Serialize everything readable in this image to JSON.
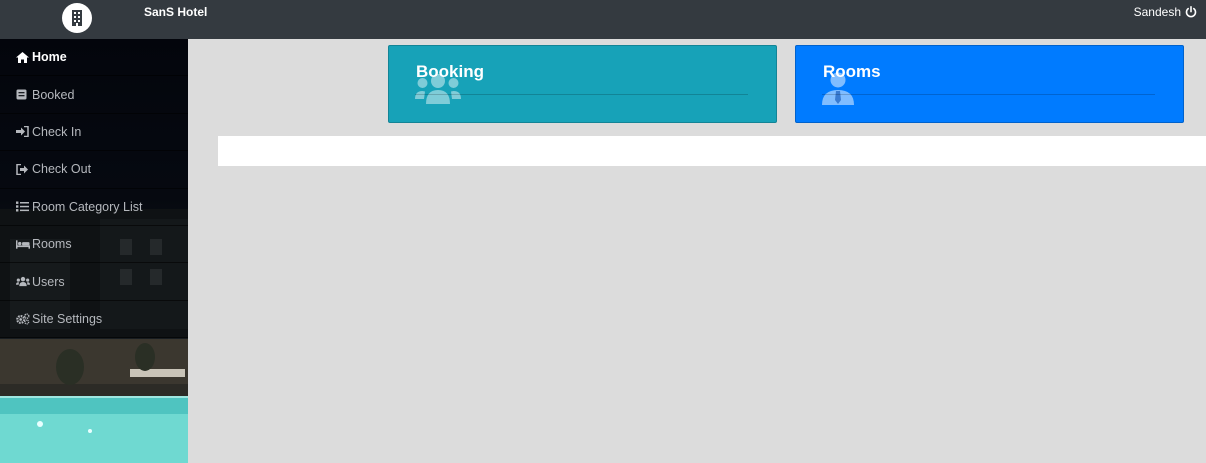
{
  "header": {
    "brand": "SanS Hotel",
    "logo_icon": "hotel-building-icon",
    "user_name": "Sandesh",
    "logout_icon": "power-icon"
  },
  "sidebar": {
    "items": [
      {
        "label": "Home",
        "icon": "home-icon",
        "active": true
      },
      {
        "label": "Booked",
        "icon": "book-icon",
        "active": false
      },
      {
        "label": "Check In",
        "icon": "sign-in-icon",
        "active": false
      },
      {
        "label": "Check Out",
        "icon": "sign-out-icon",
        "active": false
      },
      {
        "label": "Room Category List",
        "icon": "list-icon",
        "active": false
      },
      {
        "label": "Rooms",
        "icon": "bed-icon",
        "active": false
      },
      {
        "label": "Users",
        "icon": "users-icon",
        "active": false
      },
      {
        "label": "Site Settings",
        "icon": "cogs-icon",
        "active": false
      }
    ]
  },
  "cards": [
    {
      "title": "Booking",
      "icon": "users-icon",
      "color": "#17a2b8"
    },
    {
      "title": "Rooms",
      "icon": "user-tie-icon",
      "color": "#007bff"
    }
  ]
}
